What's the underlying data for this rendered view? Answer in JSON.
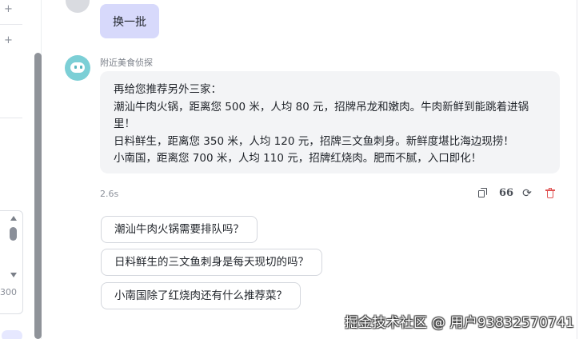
{
  "sidebar": {
    "add_icon": "plus-icon",
    "numeric_value": "300"
  },
  "user_message": {
    "text": "换一批"
  },
  "bot_message": {
    "sender": "附近美食侦探",
    "lines": [
      "再给您推荐另外三家：",
      "潮汕牛肉火锅，距离您 500 米，人均 80 元，招牌吊龙和嫩肉。牛肉新鲜到能跳着进锅里！",
      "日料鲜生，距离您 350 米，人均 120 元，招牌三文鱼刺身。新鲜度堪比海边现捞！",
      "小南国，距离您 700 米，人均 110 元，招牌红烧肉。肥而不腻，入口即化！"
    ],
    "elapsed": "2.6s",
    "actions": {
      "copy": "copy-icon",
      "quote": "66",
      "regenerate": "refresh-icon",
      "delete": "trash-icon"
    }
  },
  "suggestions": [
    "潮汕牛肉火锅需要排队吗？",
    "日料鲜生的三文鱼刺身是每天现切的吗？",
    "小南国除了红烧肉还有什么推荐菜？"
  ],
  "watermark": "掘金技术社区 @ 用户93832570741",
  "colors": {
    "user_bubble": "#d7d9fb",
    "bot_bubble": "#f3f4f6",
    "bot_avatar": "#7ccfd6",
    "delete_red": "#e05252"
  }
}
